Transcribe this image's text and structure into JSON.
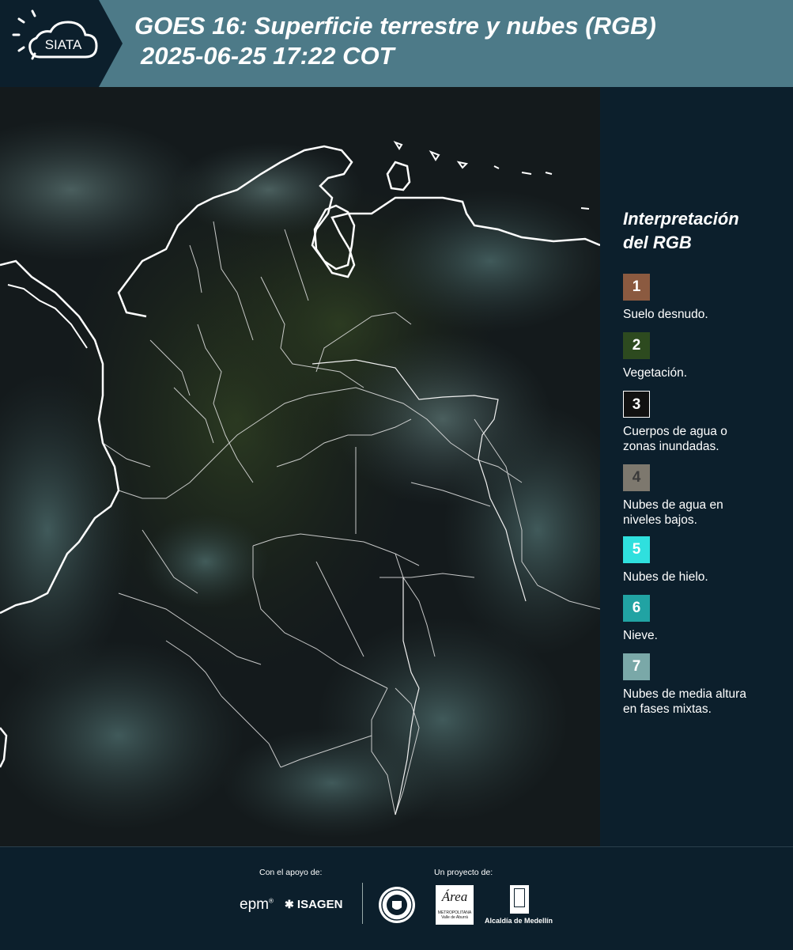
{
  "header": {
    "logo_text": "SIATA",
    "title_line1": "GOES 16: Superficie terrestre y nubes (RGB)",
    "title_line2": "2025-06-25 17:22 COT"
  },
  "legend": {
    "title_line1": "Interpretación",
    "title_line2": "del RGB",
    "items": [
      {
        "number": "1",
        "line1": "Suelo desnudo.",
        "line2": "",
        "color": "#8b5a40"
      },
      {
        "number": "2",
        "line1": "Vegetación.",
        "line2": "",
        "color": "#2d4a1f"
      },
      {
        "number": "3",
        "line1": "Cuerpos de agua o",
        "line2": "zonas inundadas.",
        "color": "#111111"
      },
      {
        "number": "4",
        "line1": "Nubes de agua en",
        "line2": "niveles bajos.",
        "color": "#7d786e"
      },
      {
        "number": "5",
        "line1": "Nubes de hielo.",
        "line2": "",
        "color": "#2fe0de"
      },
      {
        "number": "6",
        "line1": "Nieve.",
        "line2": "",
        "color": "#21a3a3"
      },
      {
        "number": "7",
        "line1": "Nubes de media altura",
        "line2": "en fases mixtas.",
        "color": "#7aa8a8"
      }
    ]
  },
  "footer": {
    "support_label": "Con el apoyo de:",
    "project_label": "Un proyecto de:",
    "sponsor_epm": "epm",
    "sponsor_isagen": "ISAGEN",
    "area_metro": "Área",
    "area_metro_sub1": "METROPOLITANA",
    "area_metro_sub2": "Valle de Aburrá",
    "alcaldia": "Alcaldía de Medellín"
  }
}
